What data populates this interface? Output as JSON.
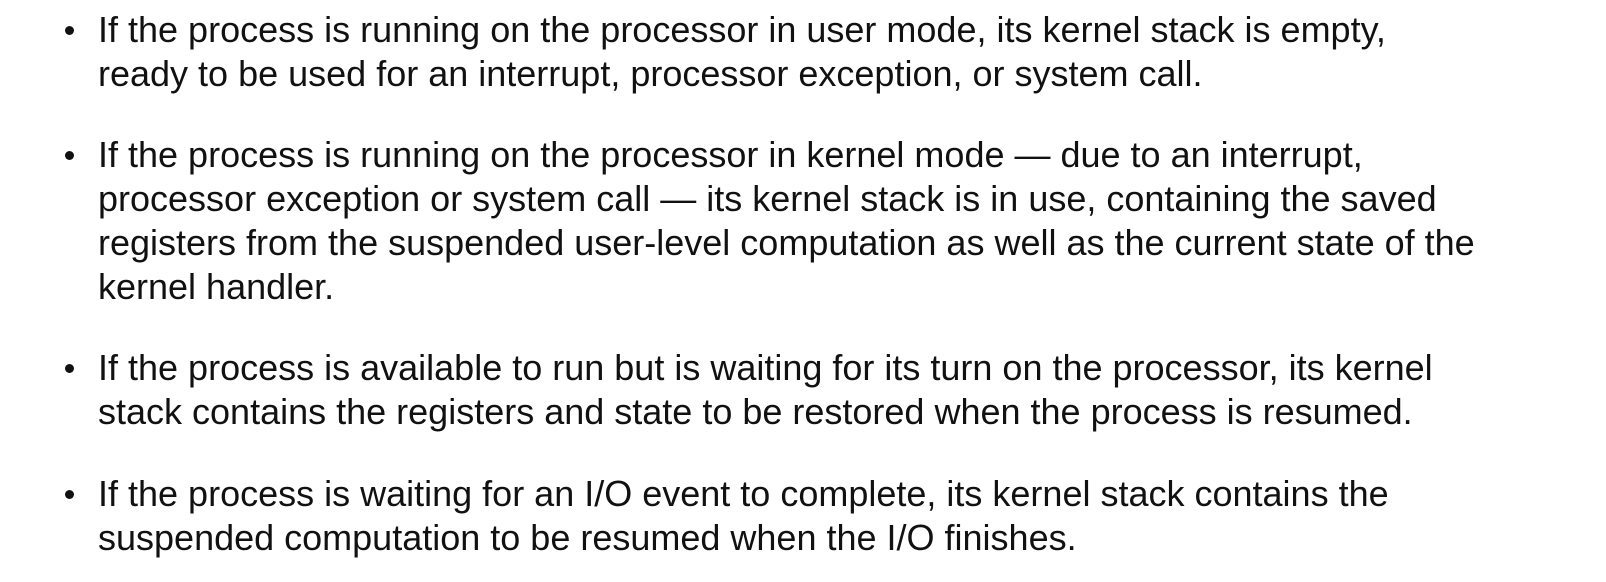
{
  "bullets": [
    {
      "lines": [
        "If the process is running on the processor in user mode, its kernel stack is empty,",
        "ready to be used for an interrupt, processor exception, or system call."
      ]
    },
    {
      "lines": [
        "If the process is running on the processor in kernel mode — due to an interrupt,",
        "processor exception or system call — its kernel stack is in use, containing the saved",
        "registers from the suspended user-level computation as well as the current state of the",
        "kernel handler."
      ]
    },
    {
      "lines": [
        "If the process is available to run but is waiting for its turn on the processor, its kernel",
        "stack contains the registers and state to be restored when the process is resumed."
      ]
    },
    {
      "lines": [
        "If the process is waiting for an I/O event to complete, its kernel stack contains the",
        "suspended computation to be resumed when the I/O finishes."
      ]
    }
  ]
}
